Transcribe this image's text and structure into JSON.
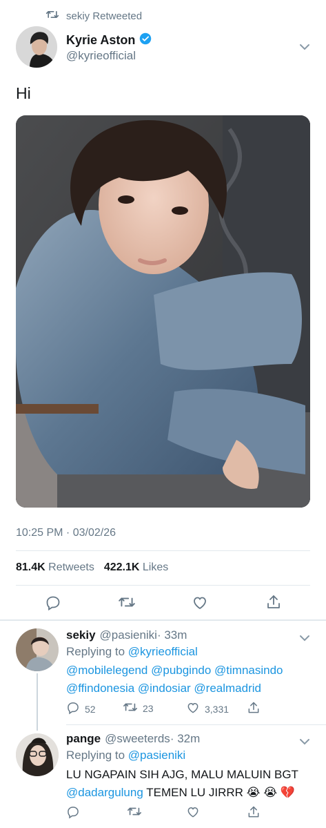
{
  "retweet_context": {
    "text": "sekiy Retweeted",
    "icon": "retweet-icon"
  },
  "tweet": {
    "author_name": "Kyrie Aston",
    "verified": true,
    "author_handle": "@kyrieofficial",
    "text": "Hi",
    "timestamp": "10:25 PM · 03/02/26",
    "retweets_count": "81.4K",
    "retweets_label": "Retweets",
    "likes_count": "422.1K",
    "likes_label": "Likes",
    "actions": [
      "reply-icon",
      "retweet-icon",
      "like-icon",
      "share-icon"
    ]
  },
  "replies": [
    {
      "name": "sekiy",
      "handle": "@pasieniki",
      "time": "· 33m",
      "replying_prefix": "Replying to",
      "replying_to": "@kyrieofficial",
      "mentions_line1": "@mobilelegend @pubgindo @timnasindo",
      "mentions_line2": "@ffindonesia @indosiar @realmadrid",
      "reply_count": "52",
      "retweet_count": "23",
      "like_count": "3,331"
    },
    {
      "name": "pange",
      "handle": "@sweeterds",
      "time": "· 32m",
      "replying_prefix": "Replying to",
      "replying_to": "@pasieniki",
      "text_line1": "LU NGAPAIN SIH AJG, MALU MALUIN BGT",
      "mention": "@dadargulung",
      "text_line2_rest": "TEMEN LU JIRRR 😭 😭 💔"
    }
  ],
  "colors": {
    "link": "#1b95e0",
    "muted": "#657786",
    "divider": "#e1e8ed",
    "verified": "#1da1f2"
  }
}
